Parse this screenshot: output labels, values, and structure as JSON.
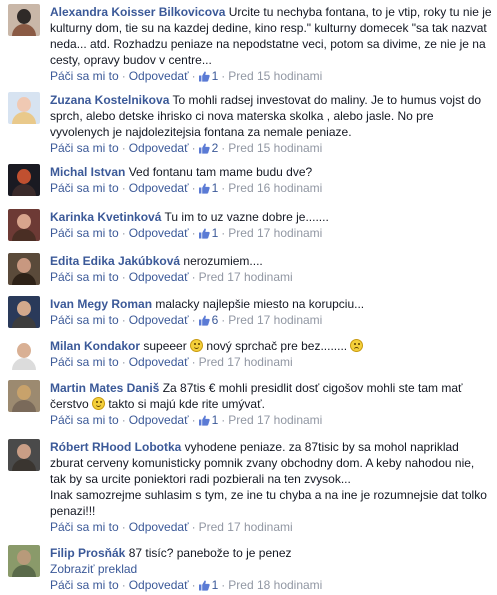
{
  "common": {
    "like_label": "Páči sa mi to",
    "reply_label": "Odpovedať",
    "separator": "·"
  },
  "comments": [
    {
      "author": "Alexandra Koisser Bilkovicova",
      "text": "Urcite tu nechyba fontana, to je vtip, roky tu nie je kulturny dom, tie su na kazdej dedine, kino resp.\" kulturny domecek \"sa tak nazvat neda... atd. Rozhadzu peniaze na nepodstatne veci, potom sa divime, ze nie je na cesty, opravy budov v centre...",
      "likes": "1",
      "time": "Pred 15 hodinami",
      "avatar_colors": [
        "#8a5a44",
        "#2f2a28",
        "#c9b7a8"
      ]
    },
    {
      "author": "Zuzana Kostelnikova",
      "text": "To mohli radsej investovat do maliny. Je to humus vojst do sprch, alebo detske ihrisko ci nova materska skolka , alebo jasle. No pre vyvolenych je najdolezitejsia fontana za nemale peniaze.",
      "likes": "2",
      "time": "Pred 15 hodinami",
      "avatar_colors": [
        "#e9c98b",
        "#f0c9b3",
        "#d7e3f1"
      ]
    },
    {
      "author": "Michal Istvan",
      "text": "Ved fontanu tam mame budu dve?",
      "likes": "1",
      "time": "Pred 16 hodinami",
      "avatar_colors": [
        "#3a2a2a",
        "#c05030",
        "#1a1a22"
      ]
    },
    {
      "author": "Karinka Kvetinková",
      "text": "Tu im to uz vazne dobre je.......",
      "likes": "1",
      "time": "Pred 17 hodinami",
      "avatar_colors": [
        "#4a2e24",
        "#d8a48c",
        "#6d3a35"
      ]
    },
    {
      "author": "Edita Edika Jakúbková",
      "text": "nerozumiem....",
      "likes": "",
      "time": "Pred 17 hodinami",
      "avatar_colors": [
        "#2e2218",
        "#c89880",
        "#5a4a3a"
      ]
    },
    {
      "author": "Ivan Megy Roman",
      "text": "malacky najlepšie miesto na korupciu...",
      "likes": "6",
      "time": "Pred 17 hodinami",
      "avatar_colors": [
        "#3d3d3d",
        "#d2a98c",
        "#2a3a5a"
      ]
    },
    {
      "author": "Milan Kondakor",
      "text_parts": [
        "supeeer ",
        " nový sprchač pre bez........ "
      ],
      "emojis": [
        "smile",
        "sad"
      ],
      "likes": "",
      "time": "Pred 17 hodinami",
      "avatar_colors": [
        "#dcdcdc",
        "#d9b094",
        "#ffffff"
      ]
    },
    {
      "author": "Martin Mates Daniš",
      "text_parts": [
        "Za 87tis € mohli presidlit dosť cigošov mohli ste tam mať čerstvo ",
        " takto si majú kde rite umývať."
      ],
      "emojis": [
        "smile"
      ],
      "likes": "1",
      "time": "Pred 17 hodinami",
      "avatar_colors": [
        "#7a6a5a",
        "#c8a26b",
        "#9c8a70"
      ]
    },
    {
      "author": "Róbert RHood Lobotka",
      "text": "vyhodene peniaze. za 87tisic by sa mohol napriklad zburat cerveny komunisticky pomnik zvany obchodny dom. A keby nahodou nie, tak by sa urcite poniektori radi pozbierali na ten zvysok...",
      "text2": "Inak samozrejme suhlasim s tym, ze ine tu chyba a na ine je rozumnejsie dat tolko penazi!!!",
      "likes": "",
      "time": "Pred 17 hodinami",
      "avatar_colors": [
        "#3a3530",
        "#c99e86",
        "#4a4a4a"
      ]
    },
    {
      "author": "Filip Prosňák",
      "text": "87 tisíc? panebože to je penez",
      "translate": "Zobraziť preklad",
      "likes": "1",
      "time": "Pred 18 hodinami",
      "avatar_colors": [
        "#5a6a4a",
        "#b89a7a",
        "#8a9a6a"
      ]
    }
  ]
}
